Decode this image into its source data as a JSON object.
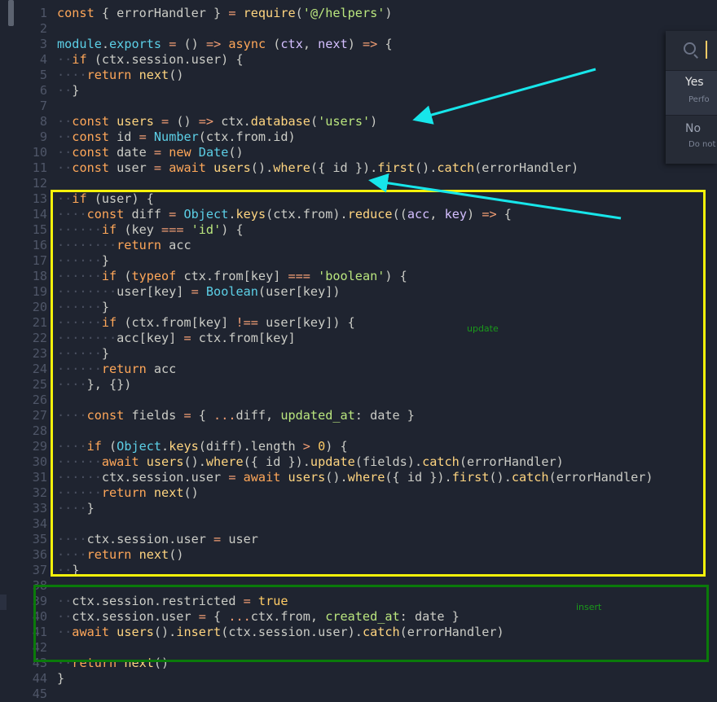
{
  "editor": {
    "language": "javascript",
    "lines": [
      {
        "n": "1",
        "html": "<span class=\"k\">const</span> { errorHandler } <span class=\"o\">=</span> <span class=\"f\">require</span>(<span class=\"s\">'@/helpers'</span>)"
      },
      {
        "n": "2",
        "html": ""
      },
      {
        "n": "3",
        "html": "<span class=\"c\">module</span>.<span class=\"c\">exports</span> <span class=\"o\">=</span> () <span class=\"o\">=&gt;</span> <span class=\"k\">async</span> (<span class=\"v\">ctx</span>, <span class=\"v\">next</span>) <span class=\"o\">=&gt;</span> {"
      },
      {
        "n": "4",
        "html": "<span class=\"dots\">··</span><span class=\"k\">if</span> (ctx.session.user) {"
      },
      {
        "n": "5",
        "html": "<span class=\"dots\">····</span><span class=\"k\">return</span> <span class=\"f\">next</span>()"
      },
      {
        "n": "6",
        "html": "<span class=\"dots\">··</span>}"
      },
      {
        "n": "7",
        "html": ""
      },
      {
        "n": "8",
        "html": "<span class=\"dots\">··</span><span class=\"k\">const</span> <span class=\"f\">users</span> <span class=\"o\">=</span> () <span class=\"o\">=&gt;</span> ctx.<span class=\"f\">database</span>(<span class=\"s\">'users'</span>)"
      },
      {
        "n": "9",
        "html": "<span class=\"dots\">··</span><span class=\"k\">const</span> id <span class=\"o\">=</span> <span class=\"c\">Number</span>(ctx.from.id)"
      },
      {
        "n": "10",
        "html": "<span class=\"dots\">··</span><span class=\"k\">const</span> date <span class=\"o\">=</span> <span class=\"k\">new</span> <span class=\"c\">Date</span>()"
      },
      {
        "n": "11",
        "html": "<span class=\"dots\">··</span><span class=\"k\">const</span> user <span class=\"o\">=</span> <span class=\"k\">await</span> <span class=\"f\">users</span>().<span class=\"f\">where</span>({ id }).<span class=\"f\">first</span>().<span class=\"f\">catch</span>(errorHandler)"
      },
      {
        "n": "12",
        "html": ""
      },
      {
        "n": "13",
        "html": "<span class=\"dots\">··</span><span class=\"k\">if</span> (user) {"
      },
      {
        "n": "14",
        "html": "<span class=\"dots\">····</span><span class=\"k\">const</span> diff <span class=\"o\">=</span> <span class=\"c\">Object</span>.<span class=\"f\">keys</span>(ctx.from).<span class=\"f\">reduce</span>((<span class=\"v\">acc</span>, <span class=\"v\">key</span>) <span class=\"o\">=&gt;</span> {"
      },
      {
        "n": "15",
        "html": "<span class=\"dots\">······</span><span class=\"k\">if</span> (key <span class=\"o\">===</span> <span class=\"s\">'id'</span>) {"
      },
      {
        "n": "16",
        "html": "<span class=\"dots\">········</span><span class=\"k\">return</span> acc"
      },
      {
        "n": "17",
        "html": "<span class=\"dots\">······</span>}"
      },
      {
        "n": "18",
        "html": "<span class=\"dots\">······</span><span class=\"k\">if</span> (<span class=\"k\">typeof</span> ctx.from[key] <span class=\"o\">===</span> <span class=\"s\">'boolean'</span>) {"
      },
      {
        "n": "19",
        "html": "<span class=\"dots\">········</span>user[key] <span class=\"o\">=</span> <span class=\"c\">Boolean</span>(user[key])"
      },
      {
        "n": "20",
        "html": "<span class=\"dots\">······</span>}"
      },
      {
        "n": "21",
        "html": "<span class=\"dots\">······</span><span class=\"k\">if</span> (ctx.from[key] <span class=\"o\">!==</span> user[key]) {"
      },
      {
        "n": "22",
        "html": "<span class=\"dots\">········</span>acc[key] <span class=\"o\">=</span> ctx.from[key]"
      },
      {
        "n": "23",
        "html": "<span class=\"dots\">······</span>}"
      },
      {
        "n": "24",
        "html": "<span class=\"dots\">······</span><span class=\"k\">return</span> acc"
      },
      {
        "n": "25",
        "html": "<span class=\"dots\">····</span>}, {})"
      },
      {
        "n": "26",
        "html": ""
      },
      {
        "n": "27",
        "html": "<span class=\"dots\">····</span><span class=\"k\">const</span> fields <span class=\"o\">=</span> { <span class=\"o\">...</span>diff, <span class=\"s\">updated_at</span>: date }"
      },
      {
        "n": "28",
        "html": ""
      },
      {
        "n": "29",
        "html": "<span class=\"dots\">····</span><span class=\"k\">if</span> (<span class=\"c\">Object</span>.<span class=\"f\">keys</span>(diff).length <span class=\"o\">&gt;</span> <span class=\"b\">0</span>) {"
      },
      {
        "n": "30",
        "html": "<span class=\"dots\">······</span><span class=\"k\">await</span> <span class=\"f\">users</span>().<span class=\"f\">where</span>({ id }).<span class=\"f\">update</span>(fields).<span class=\"f\">catch</span>(errorHandler)"
      },
      {
        "n": "31",
        "html": "<span class=\"dots\">······</span>ctx.session.user <span class=\"o\">=</span> <span class=\"k\">await</span> <span class=\"f\">users</span>().<span class=\"f\">where</span>({ id }).<span class=\"f\">first</span>().<span class=\"f\">catch</span>(errorHandler)"
      },
      {
        "n": "32",
        "html": "<span class=\"dots\">······</span><span class=\"k\">return</span> <span class=\"f\">next</span>()"
      },
      {
        "n": "33",
        "html": "<span class=\"dots\">····</span>}"
      },
      {
        "n": "34",
        "html": ""
      },
      {
        "n": "35",
        "html": "<span class=\"dots\">····</span>ctx.session.user <span class=\"o\">=</span> user"
      },
      {
        "n": "36",
        "html": "<span class=\"dots\">····</span><span class=\"k\">return</span> <span class=\"f\">next</span>()"
      },
      {
        "n": "37",
        "html": "<span class=\"dots\">··</span>}"
      },
      {
        "n": "38",
        "html": ""
      },
      {
        "n": "39",
        "html": "<span class=\"dots\">··</span>ctx.session.restricted <span class=\"o\">=</span> <span class=\"b\">true</span>"
      },
      {
        "n": "40",
        "html": "<span class=\"dots\">··</span>ctx.session.user <span class=\"o\">=</span> { <span class=\"o\">...</span>ctx.from, <span class=\"s\">created_at</span>: date }"
      },
      {
        "n": "41",
        "html": "<span class=\"dots\">··</span><span class=\"k\">await</span> <span class=\"f\">users</span>().<span class=\"f\">insert</span>(ctx.session.user).<span class=\"f\">catch</span>(errorHandler)"
      },
      {
        "n": "42",
        "html": ""
      },
      {
        "n": "43",
        "html": "<span class=\"dots\">··</span><span class=\"k\">return</span> <span class=\"f\">next</span>()"
      },
      {
        "n": "44",
        "html": "}"
      },
      {
        "n": "45",
        "html": ""
      }
    ]
  },
  "annotations": {
    "update_label": "update",
    "insert_label": "insert",
    "yellow_color": "#f5f20a",
    "green_color": "#0a7a0a",
    "arrow_color": "#17e6ea"
  },
  "find_panel": {
    "icon": "search-icon",
    "options": [
      {
        "title": "Yes",
        "description": "Perfo"
      },
      {
        "title": "No",
        "description": "Do not"
      }
    ]
  }
}
